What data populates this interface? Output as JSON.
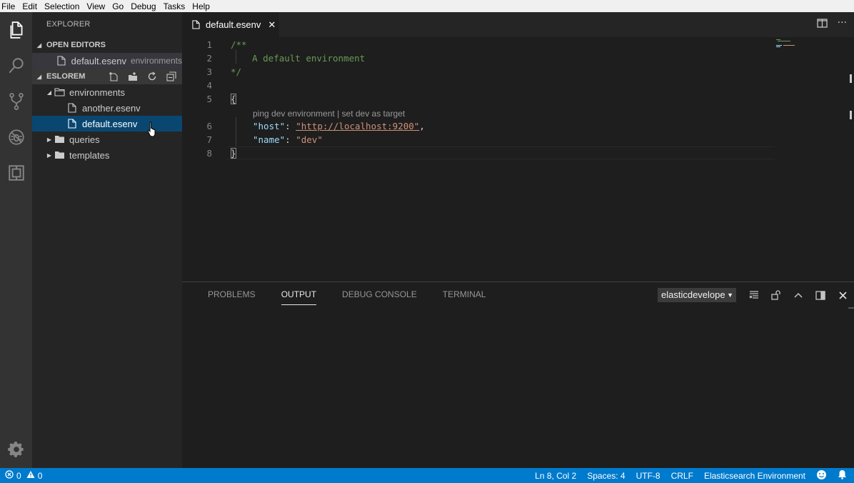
{
  "menu": [
    "File",
    "Edit",
    "Selection",
    "View",
    "Go",
    "Debug",
    "Tasks",
    "Help"
  ],
  "activity_bar": [
    "files-icon",
    "search-icon",
    "source-control-icon",
    "debug-icon",
    "extensions-icon",
    "settings-gear-icon"
  ],
  "sidebar": {
    "title": "EXPLORER",
    "open_editors": {
      "header": "OPEN EDITORS",
      "items": [
        {
          "name": "default.esenv",
          "description": "environments"
        }
      ]
    },
    "folder": {
      "header": "ESLOREM",
      "actions": [
        "new-file-icon",
        "new-folder-icon",
        "refresh-icon",
        "collapse-all-icon"
      ],
      "tree": [
        {
          "name": "environments",
          "type": "folder",
          "expanded": true
        },
        {
          "name": "another.esenv",
          "type": "file"
        },
        {
          "name": "default.esenv",
          "type": "file",
          "selected": true
        },
        {
          "name": "queries",
          "type": "folder",
          "expanded": false
        },
        {
          "name": "templates",
          "type": "folder",
          "expanded": false
        }
      ]
    }
  },
  "tab": {
    "label": "default.esenv",
    "close": "✕"
  },
  "editor": {
    "line_numbers": [
      "1",
      "2",
      "3",
      "4",
      "5",
      "6",
      "7",
      "8"
    ],
    "lines": {
      "l1": "/**",
      "l2": "    A default environment",
      "l3": "*/",
      "l5": "{",
      "host_key": "\"host\"",
      "host_val": "\"http://localhost:9200\"",
      "name_key": "\"name\"",
      "name_val": "\"dev\"",
      "l8": "}"
    },
    "codelens": "ping dev environment | set dev as target"
  },
  "panel": {
    "tabs": [
      "PROBLEMS",
      "OUTPUT",
      "DEBUG CONSOLE",
      "TERMINAL"
    ],
    "active_tab": "OUTPUT",
    "output_channel": "elasticdeveloper",
    "actions": [
      "clear-output-icon",
      "lock-scroll-icon",
      "maximize-panel-icon",
      "toggle-panel-position-icon",
      "close-panel-icon"
    ]
  },
  "statusbar": {
    "errors": "0",
    "warnings": "0",
    "position": "Ln 8, Col 2",
    "spaces": "Spaces: 4",
    "encoding": "UTF-8",
    "eol": "CRLF",
    "language": "Elasticsearch Environment"
  },
  "colors": {
    "accent": "#007acc",
    "selection": "#094771"
  }
}
